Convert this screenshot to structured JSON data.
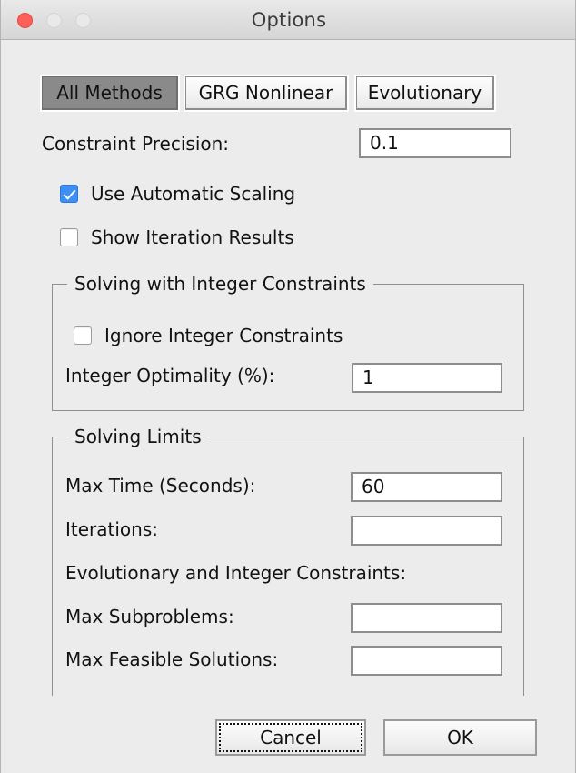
{
  "window": {
    "title": "Options",
    "traffic_lights": {
      "close": "close-button",
      "minimize": "minimize-button",
      "zoom": "zoom-button"
    },
    "accent_colors": {
      "close_red": "#fc6058",
      "checkbox_blue": "#3d8ef5",
      "selected_tab_grey": "#8a8a8a",
      "window_background": "#ececec"
    }
  },
  "tabs": [
    {
      "label": "All Methods",
      "selected": true
    },
    {
      "label": "GRG Nonlinear",
      "selected": false
    },
    {
      "label": "Evolutionary",
      "selected": false
    }
  ],
  "main": {
    "constraint_precision": {
      "label": "Constraint Precision:",
      "value": "0.1",
      "placeholder": ""
    },
    "checkboxes": [
      {
        "label": "Use Automatic Scaling",
        "checked": true
      },
      {
        "label": "Show Iteration Results",
        "checked": false
      }
    ]
  },
  "integer_group": {
    "title": "Solving with Integer Constraints",
    "ignore_integer": {
      "label": "Ignore Integer Constraints",
      "checked": false
    },
    "integer_optimality": {
      "label": "Integer Optimality (%):",
      "value": "1",
      "placeholder": ""
    }
  },
  "limits_group": {
    "title": "Solving Limits",
    "max_time": {
      "label": "Max Time (Seconds):",
      "value": "60",
      "placeholder": ""
    },
    "iterations": {
      "label": "Iterations:",
      "value": "",
      "placeholder": ""
    },
    "subsection_label": "Evolutionary and Integer Constraints:",
    "max_subproblems": {
      "label": "Max Subproblems:",
      "value": "",
      "placeholder": ""
    },
    "max_feasible_solutions": {
      "label": "Max Feasible Solutions:",
      "value": "",
      "placeholder": ""
    }
  },
  "footer": {
    "cancel_label": "Cancel",
    "ok_label": "OK"
  }
}
